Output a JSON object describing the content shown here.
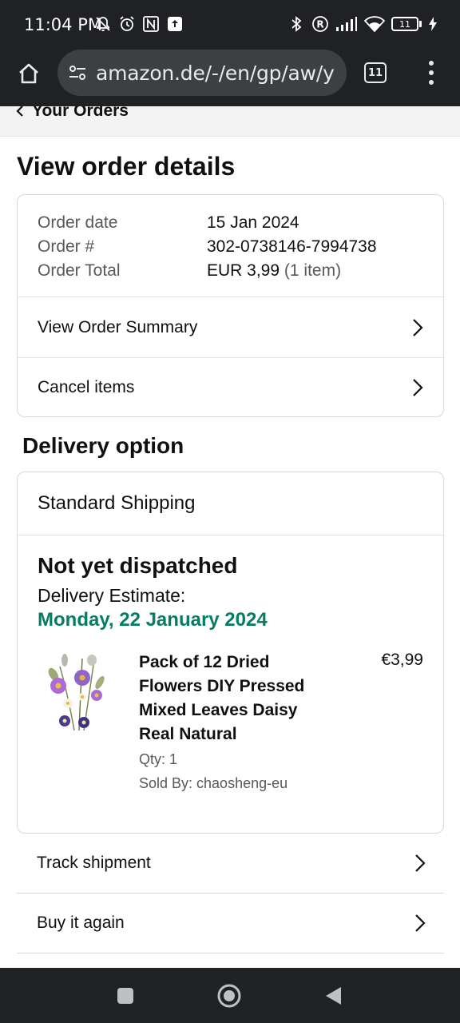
{
  "status_bar": {
    "time": "11:04 PM",
    "battery": "11",
    "icons_left": [
      "mute-icon",
      "alarm-icon",
      "nfc-icon",
      "upload-icon"
    ],
    "icons_right": [
      "bluetooth-icon",
      "registered-icon",
      "signal-icon",
      "wifi-icon",
      "battery-icon",
      "charging-icon"
    ]
  },
  "browser": {
    "url": "amazon.de/-/en/gp/aw/y",
    "tab_count": "11"
  },
  "breadcrumb": {
    "label": "Your Orders"
  },
  "page": {
    "title": "View order details"
  },
  "order": {
    "rows": [
      {
        "label": "Order date",
        "value": "15 Jan 2024",
        "extra": ""
      },
      {
        "label": "Order #",
        "value": "302-0738146-7994738",
        "extra": ""
      },
      {
        "label": "Order Total",
        "value": "EUR 3,99",
        "extra": "(1 item)"
      }
    ],
    "links": [
      {
        "label": "View Order Summary"
      },
      {
        "label": "Cancel items"
      }
    ]
  },
  "delivery": {
    "section_title": "Delivery option",
    "shipping_method": "Standard Shipping",
    "status": "Not yet dispatched",
    "estimate_label": "Delivery Estimate:",
    "estimate_date": "Monday, 22 January 2024",
    "product": {
      "title": "Pack of 12 Dried Flowers DIY Pressed Mixed Leaves Daisy Real Natural",
      "price": "€3,99",
      "qty": "Qty: 1",
      "seller": "Sold By: chaosheng-eu"
    }
  },
  "actions": [
    {
      "label": "Track shipment"
    },
    {
      "label": "Buy it again"
    }
  ],
  "colors": {
    "accent_green": "#067d62",
    "system_bar": "#202124",
    "text": "#0f1111",
    "muted": "#565959"
  }
}
